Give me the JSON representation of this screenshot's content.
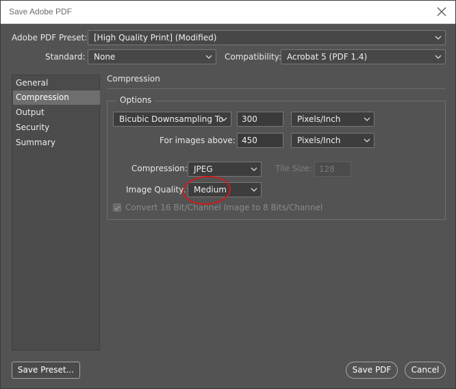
{
  "window": {
    "title": "Save Adobe PDF"
  },
  "preset": {
    "label": "Adobe PDF Preset:",
    "value": "[High Quality Print] (Modified)"
  },
  "standard": {
    "label": "Standard:",
    "value": "None"
  },
  "compatibility": {
    "label": "Compatibility:",
    "value": "Acrobat 5 (PDF 1.4)"
  },
  "sidebar": {
    "items": [
      {
        "label": "General"
      },
      {
        "label": "Compression"
      },
      {
        "label": "Output"
      },
      {
        "label": "Security"
      },
      {
        "label": "Summary"
      }
    ],
    "selected": "Compression"
  },
  "section": {
    "title": "Compression"
  },
  "options": {
    "legend": "Options",
    "downsampling": {
      "value": "Bicubic Downsampling To",
      "ppi": "300",
      "unit": "Pixels/Inch"
    },
    "above": {
      "label": "For images above:",
      "ppi": "450",
      "unit": "Pixels/Inch"
    },
    "compression": {
      "label": "Compression:",
      "value": "JPEG"
    },
    "tile_size": {
      "label": "Tile Size:",
      "value": "128"
    },
    "image_quality": {
      "label": "Image Quality:",
      "value": "Medium"
    },
    "convert": {
      "label": "Convert 16 Bit/Channel Image to 8 Bits/Channel",
      "checked": true
    }
  },
  "buttons": {
    "save_preset": "Save Preset...",
    "save_pdf": "Save PDF",
    "cancel": "Cancel"
  },
  "colors": {
    "panel": "#535353",
    "annotation": "#d01c1c"
  },
  "icons": {
    "close": "close-icon",
    "chevron": "chevron-down-icon",
    "check": "checkmark-icon"
  }
}
